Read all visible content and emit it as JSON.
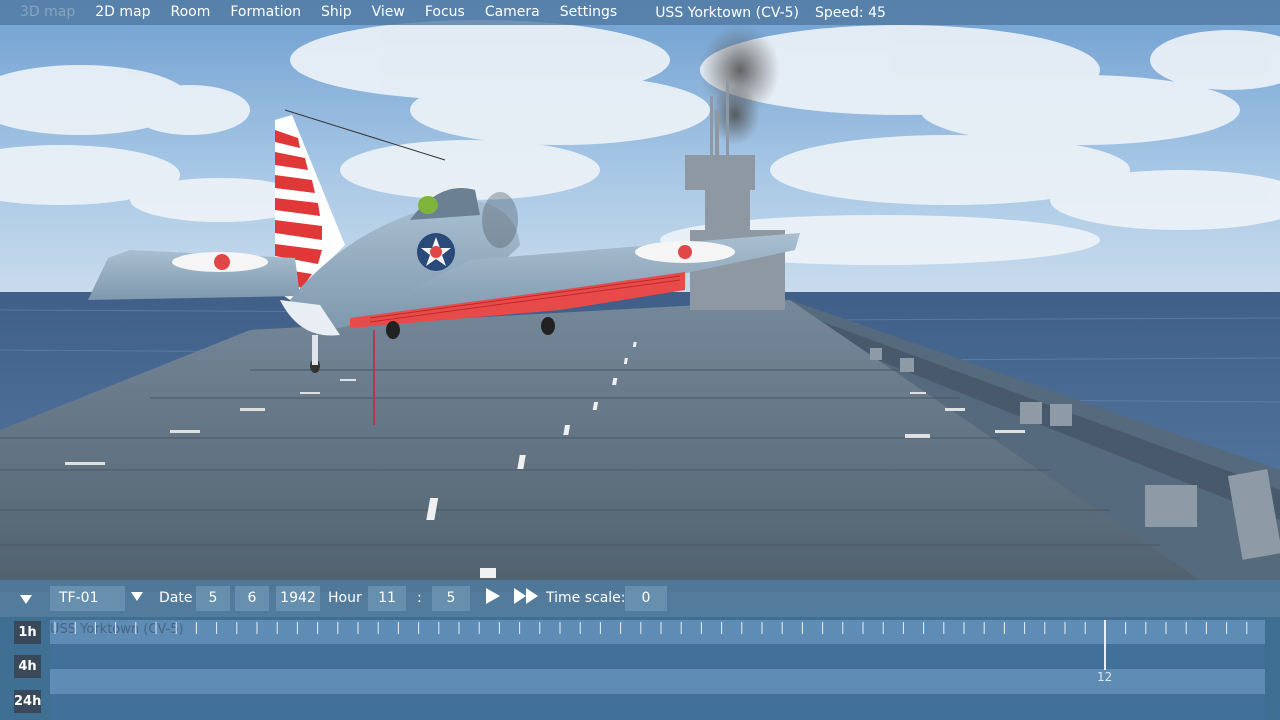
{
  "menu": {
    "items": [
      {
        "label": "3D map",
        "enabled": false
      },
      {
        "label": "2D map",
        "enabled": true
      },
      {
        "label": "Room",
        "enabled": true
      },
      {
        "label": "Formation",
        "enabled": true
      },
      {
        "label": "Ship",
        "enabled": true
      },
      {
        "label": "View",
        "enabled": true
      },
      {
        "label": "Focus",
        "enabled": true
      },
      {
        "label": "Camera",
        "enabled": true
      },
      {
        "label": "Settings",
        "enabled": true
      }
    ],
    "ship_name": "USS Yorktown (CV-5)",
    "speed_text": "Speed: 45"
  },
  "controls": {
    "task_force": "TF-01",
    "date_label": "Date",
    "month": "5",
    "day": "6",
    "year": "1942",
    "hour_label": "Hour",
    "hour": "11",
    "separator": ":",
    "minute": "5",
    "time_scale_label": "Time scale:",
    "time_scale": "0"
  },
  "timeline": {
    "zoom_buttons": [
      "1h",
      "4h",
      "24h"
    ],
    "track_ship_name": "USS Yorktown (CV-5)",
    "cursor_label": "12"
  },
  "colors": {
    "menu_bg": "#5078a0",
    "timeline_bg": "#3f6f93",
    "track_light": "#5f8cb4",
    "track_dark": "#41719a",
    "insignia_red": "#e04848",
    "rudder_red": "#e03838"
  }
}
